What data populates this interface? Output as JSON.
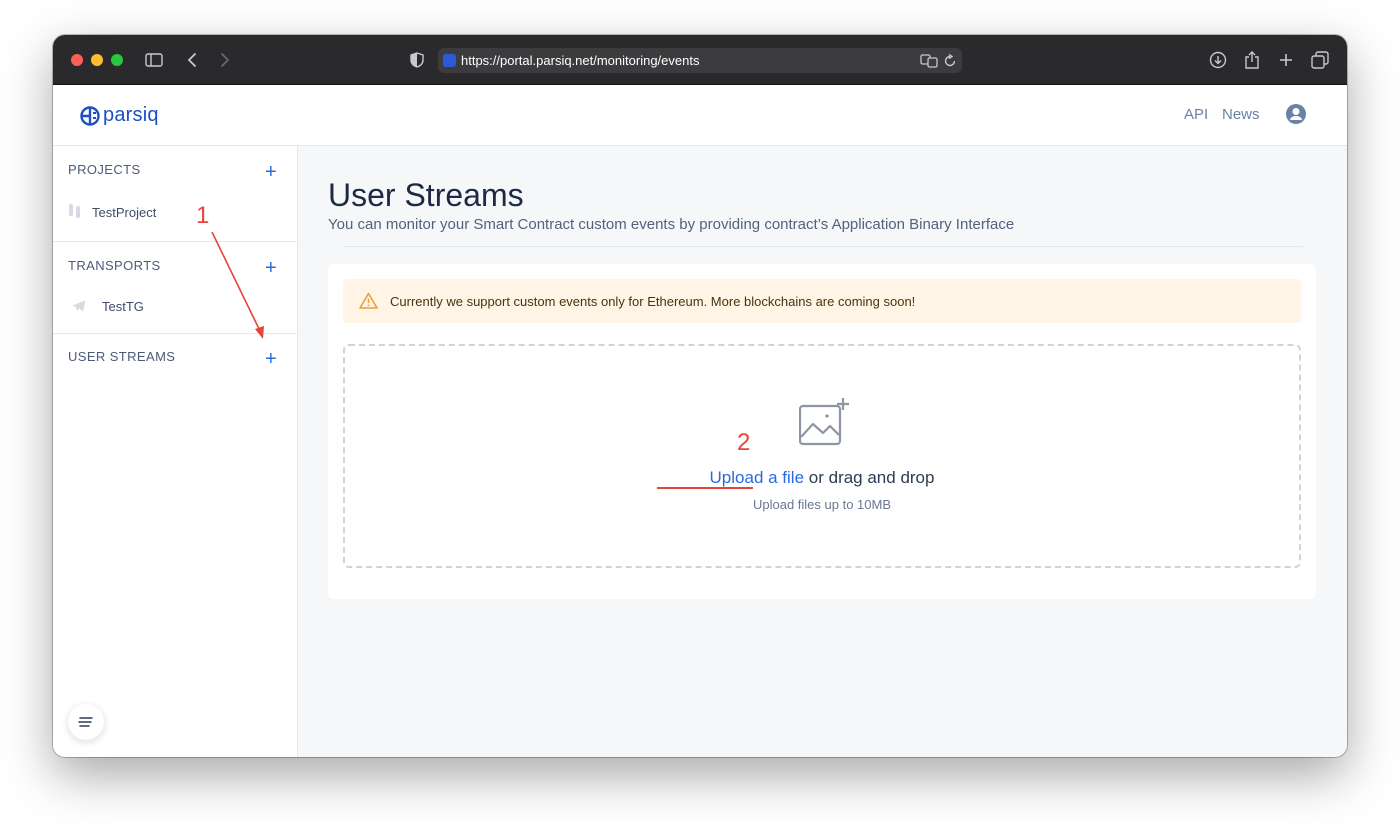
{
  "browser": {
    "url": "https://portal.parsiq.net/monitoring/events"
  },
  "header": {
    "logo_text": "parsiq",
    "links": [
      "API",
      "News"
    ]
  },
  "sidebar": {
    "projects": {
      "title": "PROJECTS",
      "items": [
        "TestProject"
      ]
    },
    "transports": {
      "title": "TRANSPORTS",
      "items": [
        "TestTG"
      ]
    },
    "user_streams": {
      "title": "USER STREAMS"
    }
  },
  "main": {
    "title": "User Streams",
    "subtitle": "You can monitor your Smart Contract custom events by providing contract’s Application Binary Interface",
    "alert": "Currently we support custom events only for Ethereum. More blockchains are coming soon!",
    "dropzone": {
      "upload_link": "Upload a file",
      "drag_text": " or drag and drop",
      "hint": "Upload files up to 10MB"
    }
  },
  "annotations": [
    "1",
    "2"
  ],
  "colors": {
    "accent": "#2a6ae0",
    "alert_bg": "#fff4e5",
    "annotation": "#e8453a"
  }
}
